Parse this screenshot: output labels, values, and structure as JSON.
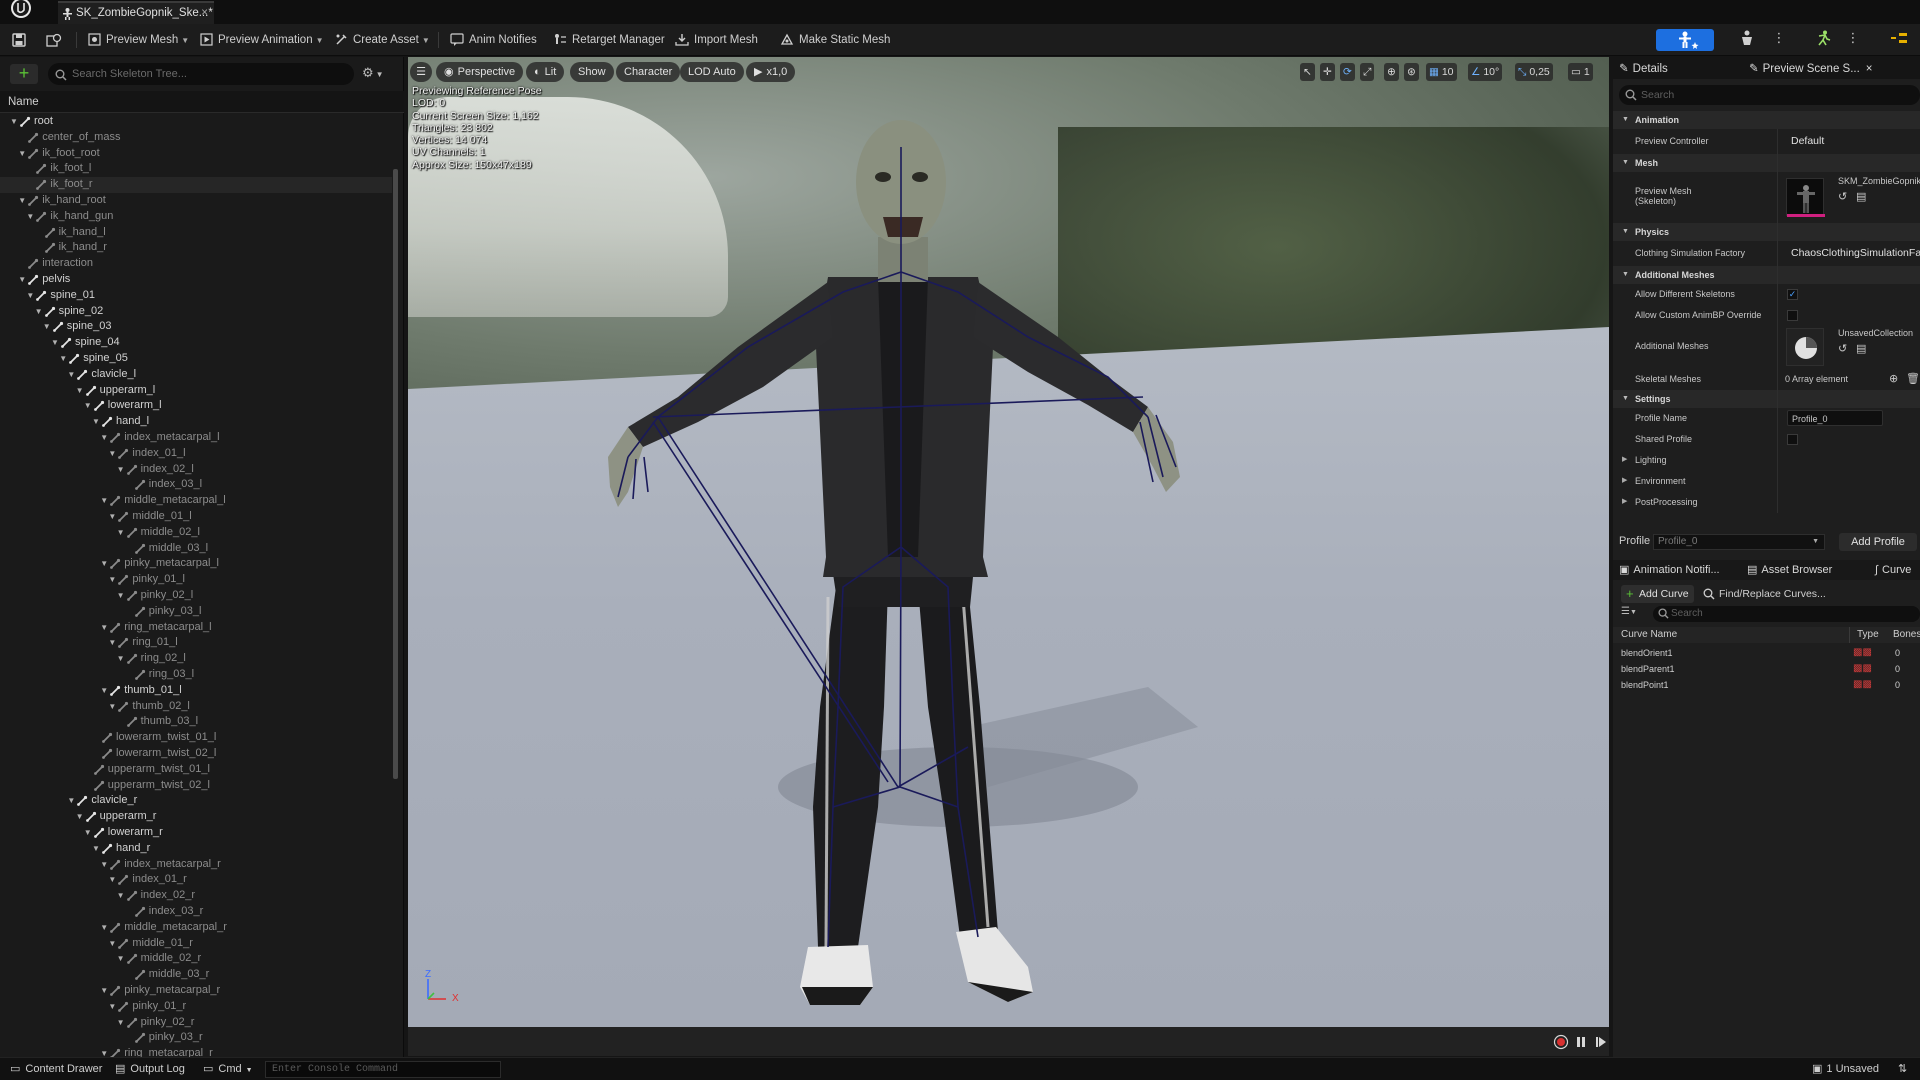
{
  "window": {
    "asset_tab": "SK_ZombieGopnik_Ske...*",
    "tab_close": "×"
  },
  "toolbar": {
    "preview_mesh": "Preview Mesh",
    "preview_animation": "Preview Animation",
    "create_asset": "Create Asset",
    "anim_notifies": "Anim Notifies",
    "retarget_manager": "Retarget Manager",
    "import_mesh": "Import Mesh",
    "make_static_mesh": "Make Static Mesh"
  },
  "skeleton_tree": {
    "search_placeholder": "Search Skeleton Tree...",
    "column_name": "Name",
    "bones": [
      {
        "name": "root",
        "depth": 0,
        "arrow": true,
        "dim": false
      },
      {
        "name": "center_of_mass",
        "depth": 1,
        "arrow": false,
        "dim": true
      },
      {
        "name": "ik_foot_root",
        "depth": 1,
        "arrow": true,
        "dim": true
      },
      {
        "name": "ik_foot_l",
        "depth": 2,
        "arrow": false,
        "dim": true
      },
      {
        "name": "ik_foot_r",
        "depth": 2,
        "arrow": false,
        "dim": true,
        "selected": true
      },
      {
        "name": "ik_hand_root",
        "depth": 1,
        "arrow": true,
        "dim": true
      },
      {
        "name": "ik_hand_gun",
        "depth": 2,
        "arrow": true,
        "dim": true
      },
      {
        "name": "ik_hand_l",
        "depth": 3,
        "arrow": false,
        "dim": true
      },
      {
        "name": "ik_hand_r",
        "depth": 3,
        "arrow": false,
        "dim": true
      },
      {
        "name": "interaction",
        "depth": 1,
        "arrow": false,
        "dim": true
      },
      {
        "name": "pelvis",
        "depth": 1,
        "arrow": true,
        "dim": false
      },
      {
        "name": "spine_01",
        "depth": 2,
        "arrow": true,
        "dim": false
      },
      {
        "name": "spine_02",
        "depth": 3,
        "arrow": true,
        "dim": false
      },
      {
        "name": "spine_03",
        "depth": 4,
        "arrow": true,
        "dim": false
      },
      {
        "name": "spine_04",
        "depth": 5,
        "arrow": true,
        "dim": false
      },
      {
        "name": "spine_05",
        "depth": 6,
        "arrow": true,
        "dim": false
      },
      {
        "name": "clavicle_l",
        "depth": 7,
        "arrow": true,
        "dim": false
      },
      {
        "name": "upperarm_l",
        "depth": 8,
        "arrow": true,
        "dim": false
      },
      {
        "name": "lowerarm_l",
        "depth": 9,
        "arrow": true,
        "dim": false
      },
      {
        "name": "hand_l",
        "depth": 10,
        "arrow": true,
        "dim": false
      },
      {
        "name": "index_metacarpal_l",
        "depth": 11,
        "arrow": true,
        "dim": true
      },
      {
        "name": "index_01_l",
        "depth": 12,
        "arrow": true,
        "dim": true
      },
      {
        "name": "index_02_l",
        "depth": 13,
        "arrow": true,
        "dim": true
      },
      {
        "name": "index_03_l",
        "depth": 14,
        "arrow": false,
        "dim": true
      },
      {
        "name": "middle_metacarpal_l",
        "depth": 11,
        "arrow": true,
        "dim": true
      },
      {
        "name": "middle_01_l",
        "depth": 12,
        "arrow": true,
        "dim": true
      },
      {
        "name": "middle_02_l",
        "depth": 13,
        "arrow": true,
        "dim": true
      },
      {
        "name": "middle_03_l",
        "depth": 14,
        "arrow": false,
        "dim": true
      },
      {
        "name": "pinky_metacarpal_l",
        "depth": 11,
        "arrow": true,
        "dim": true
      },
      {
        "name": "pinky_01_l",
        "depth": 12,
        "arrow": true,
        "dim": true
      },
      {
        "name": "pinky_02_l",
        "depth": 13,
        "arrow": true,
        "dim": true
      },
      {
        "name": "pinky_03_l",
        "depth": 14,
        "arrow": false,
        "dim": true
      },
      {
        "name": "ring_metacarpal_l",
        "depth": 11,
        "arrow": true,
        "dim": true
      },
      {
        "name": "ring_01_l",
        "depth": 12,
        "arrow": true,
        "dim": true
      },
      {
        "name": "ring_02_l",
        "depth": 13,
        "arrow": true,
        "dim": true
      },
      {
        "name": "ring_03_l",
        "depth": 14,
        "arrow": false,
        "dim": true
      },
      {
        "name": "thumb_01_l",
        "depth": 11,
        "arrow": true,
        "dim": false
      },
      {
        "name": "thumb_02_l",
        "depth": 12,
        "arrow": true,
        "dim": true
      },
      {
        "name": "thumb_03_l",
        "depth": 13,
        "arrow": false,
        "dim": true
      },
      {
        "name": "lowerarm_twist_01_l",
        "depth": 10,
        "arrow": false,
        "dim": true
      },
      {
        "name": "lowerarm_twist_02_l",
        "depth": 10,
        "arrow": false,
        "dim": true
      },
      {
        "name": "upperarm_twist_01_l",
        "depth": 9,
        "arrow": false,
        "dim": true
      },
      {
        "name": "upperarm_twist_02_l",
        "depth": 9,
        "arrow": false,
        "dim": true
      },
      {
        "name": "clavicle_r",
        "depth": 7,
        "arrow": true,
        "dim": false
      },
      {
        "name": "upperarm_r",
        "depth": 8,
        "arrow": true,
        "dim": false
      },
      {
        "name": "lowerarm_r",
        "depth": 9,
        "arrow": true,
        "dim": false
      },
      {
        "name": "hand_r",
        "depth": 10,
        "arrow": true,
        "dim": false
      },
      {
        "name": "index_metacarpal_r",
        "depth": 11,
        "arrow": true,
        "dim": true
      },
      {
        "name": "index_01_r",
        "depth": 12,
        "arrow": true,
        "dim": true
      },
      {
        "name": "index_02_r",
        "depth": 13,
        "arrow": true,
        "dim": true
      },
      {
        "name": "index_03_r",
        "depth": 14,
        "arrow": false,
        "dim": true
      },
      {
        "name": "middle_metacarpal_r",
        "depth": 11,
        "arrow": true,
        "dim": true
      },
      {
        "name": "middle_01_r",
        "depth": 12,
        "arrow": true,
        "dim": true
      },
      {
        "name": "middle_02_r",
        "depth": 13,
        "arrow": true,
        "dim": true
      },
      {
        "name": "middle_03_r",
        "depth": 14,
        "arrow": false,
        "dim": true
      },
      {
        "name": "pinky_metacarpal_r",
        "depth": 11,
        "arrow": true,
        "dim": true
      },
      {
        "name": "pinky_01_r",
        "depth": 12,
        "arrow": true,
        "dim": true
      },
      {
        "name": "pinky_02_r",
        "depth": 13,
        "arrow": true,
        "dim": true
      },
      {
        "name": "pinky_03_r",
        "depth": 14,
        "arrow": false,
        "dim": true
      },
      {
        "name": "ring_metacarpal_r",
        "depth": 11,
        "arrow": true,
        "dim": true
      }
    ]
  },
  "viewport": {
    "perspective": "Perspective",
    "lit": "Lit",
    "show": "Show",
    "character": "Character",
    "lod": "LOD Auto",
    "speed": "x1,0",
    "grid_size": "10",
    "rot_snap": "10°",
    "scale_snap": "0,25",
    "camera_speed": "1",
    "stats": [
      "Previewing Reference Pose",
      "LOD: 0",
      "Current Screen Size: 1,162",
      "Triangles: 23 802",
      "Vertices: 14 074",
      "UV Channels: 1",
      "Approx Size: 150x47x189"
    ],
    "axis_z": "Z",
    "axis_x": "X"
  },
  "details": {
    "tab_details": "Details",
    "tab_preview_scene": "Preview Scene S...",
    "search_placeholder": "Search",
    "animation_cat": "Animation",
    "preview_controller_label": "Preview Controller",
    "preview_controller_value": "Default",
    "mesh_cat": "Mesh",
    "preview_mesh_label": "Preview Mesh\n(Skeleton)",
    "preview_mesh_value": "SKM_ZombieGopnik",
    "physics_cat": "Physics",
    "clothing_label": "Clothing Simulation Factory",
    "clothing_value": "ChaosClothingSimulationFa",
    "additional_meshes_cat": "Additional Meshes",
    "allow_diff_label": "Allow Different Skeletons",
    "allow_custom_label": "Allow Custom AnimBP Override",
    "additional_meshes_label": "Additional Meshes",
    "additional_meshes_value": "UnsavedCollection",
    "skeletal_meshes_label": "Skeletal Meshes",
    "skeletal_meshes_value": "0 Array element",
    "settings_cat": "Settings",
    "profile_name_label": "Profile Name",
    "profile_name_value": "Profile_0",
    "shared_profile_label": "Shared Profile",
    "lighting": "Lighting",
    "environment": "Environment",
    "postprocessing": "PostProcessing",
    "profile_label": "Profile",
    "profile_select": "Profile_0",
    "add_profile": "Add Profile"
  },
  "curves": {
    "tab_notifies": "Animation Notifi...",
    "tab_asset_browser": "Asset Browser",
    "tab_curves": "Curve",
    "add_curve": "Add Curve",
    "find_replace": "Find/Replace Curves...",
    "search_placeholder": "Search",
    "col_name": "Curve Name",
    "col_type": "Type",
    "col_bones": "Bones",
    "rows": [
      {
        "name": "blendOrient1",
        "bones": "0"
      },
      {
        "name": "blendParent1",
        "bones": "0"
      },
      {
        "name": "blendPoint1",
        "bones": "0"
      }
    ]
  },
  "statusbar": {
    "content_drawer": "Content Drawer",
    "output_log": "Output Log",
    "cmd": "Cmd",
    "console_placeholder": "Enter Console Command",
    "unsaved": "1 Unsaved"
  },
  "colors": {
    "accent_blue": "#1d6fe0",
    "add_green": "#5bc236",
    "skeleton_line": "#1a1a5a"
  }
}
